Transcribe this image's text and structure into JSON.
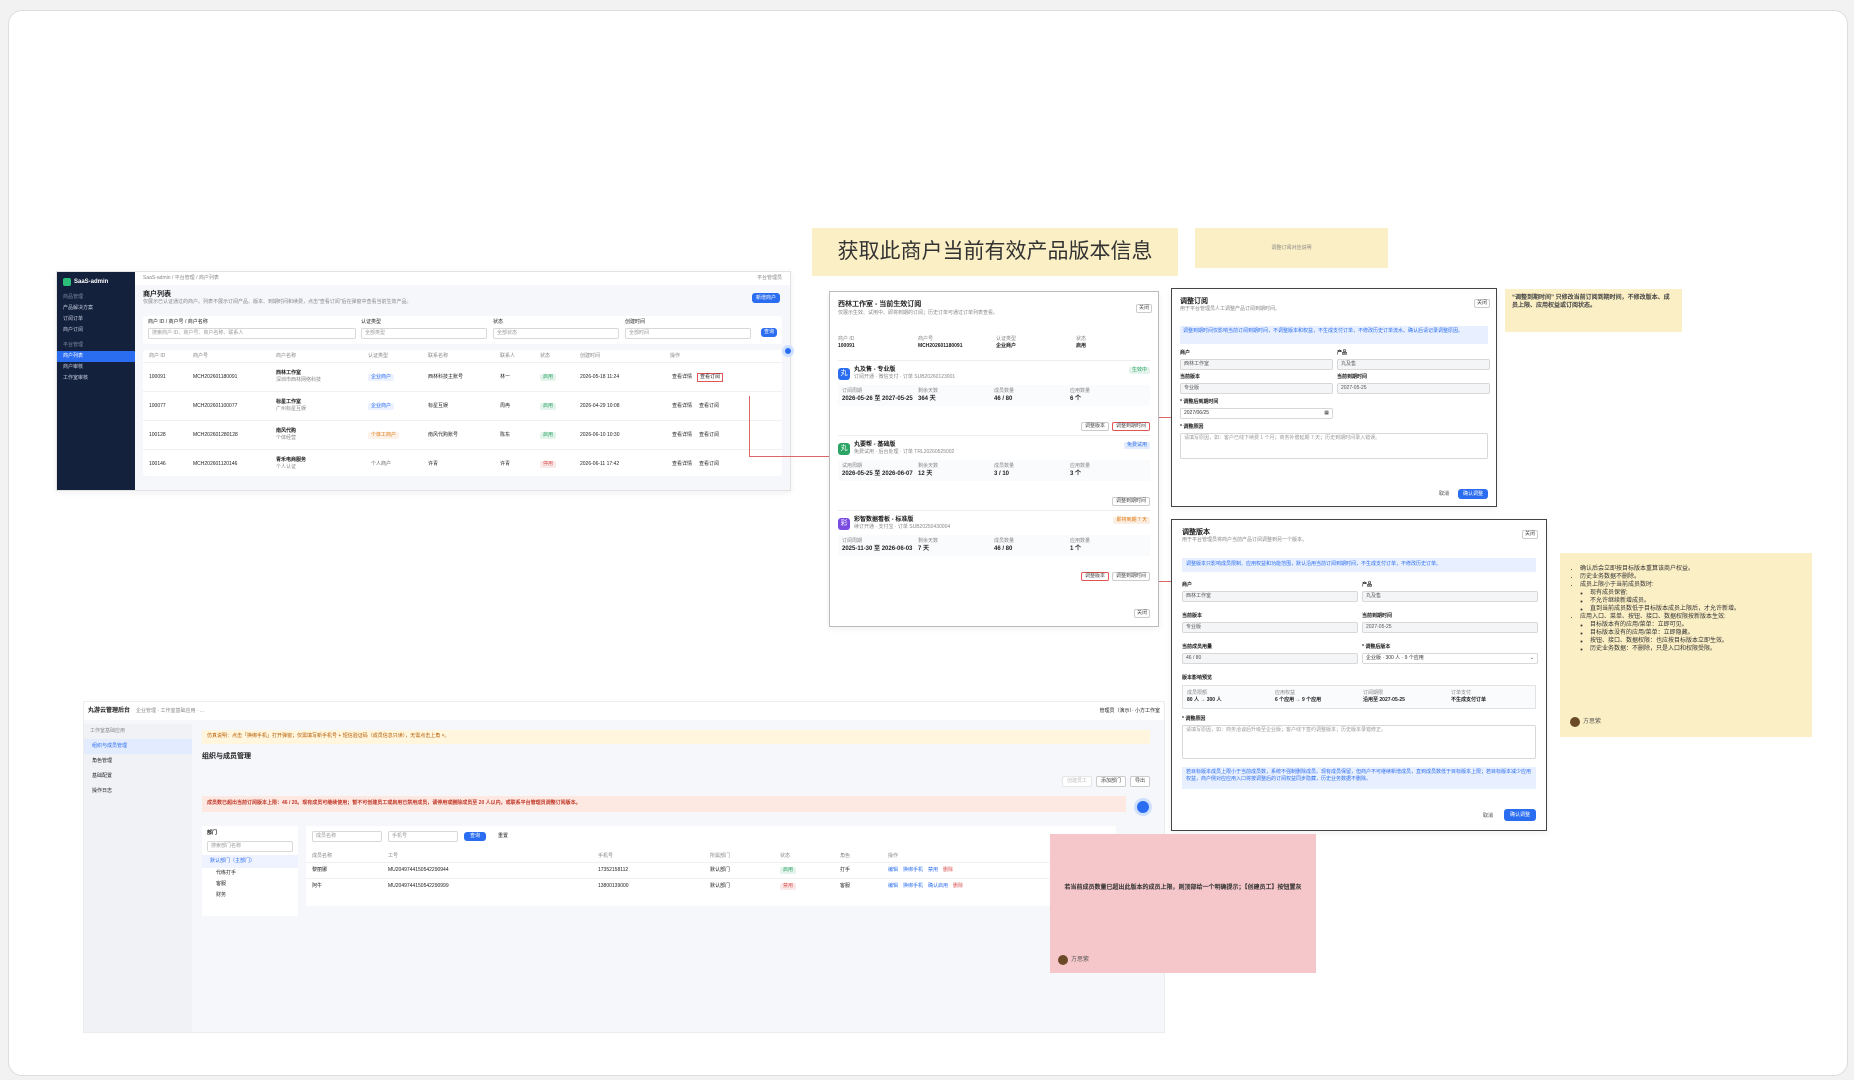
{
  "headline_note": {
    "text": "获取此商户当前有效产品版本信息"
  },
  "small_note": {
    "text": "调整订阅对应说明"
  },
  "right_note": {
    "text": "“调整到期时间” 只修改当前订阅到期时间，不修改版本、成员上限、应用权益或订阅状态。"
  },
  "rules_note": {
    "items": [
      {
        "text": "确认后会立即按目标版本重算该商户权益。"
      },
      {
        "text": "历史业务数据不删除。"
      },
      {
        "text": "成员上限小于当前成员数时:",
        "sub": [
          "现有成员保留;",
          "不允许继续新增成员。",
          "直到当前成员数低于目标版本成员上限后，才允许新增。"
        ]
      },
      {
        "text": "应用入口、菜单、按钮、接口、数据权限按新版本生效:",
        "sub": [
          "目标版本有的应用/菜单：立即可见。",
          "目标版本没有的应用/菜单：立即隐藏。",
          "按钮、接口、数据权限：也应按目标版本立即生效。",
          "历史业务数据：不删除，只是入口和权限受限。"
        ]
      }
    ],
    "author": "方思紫"
  },
  "pink_note": {
    "text": "若当前成员数量已超出此版本的成员上限，则顶部给一个明确提示；【创建员工】按钮置灰",
    "author": "方思紫"
  },
  "admin": {
    "brand": "SaaS-admin",
    "breadcrumb": "SaaS-admin / 平台管理 / 商户列表",
    "user": "平台管理员",
    "side_groups": [
      {
        "title": "商品管理",
        "items": [
          "产品解决方案",
          "订阅订单",
          "商户订阅"
        ]
      },
      {
        "title": "平台管理",
        "items": [
          "商户列表",
          "商户审核",
          "工作室审核"
        ]
      }
    ],
    "active_item": "商户列表",
    "title": "商户列表",
    "subtitle": "仅展示已认证通过的商户。列表不展示订阅产品、版本、到期时间和续费，点击\"查看订阅\"后在弹窗中查看当前生效产品。",
    "add_button": "新增商户",
    "filters": [
      {
        "label": "商户 ID / 商户号 / 商户名称",
        "placeholder": "搜索商户 ID、商户号、商户名称、联系人"
      },
      {
        "label": "认证类型",
        "placeholder": "全部类型"
      },
      {
        "label": "状态",
        "placeholder": "全部状态"
      },
      {
        "label": "创建时间",
        "placeholder": "全部时间"
      }
    ],
    "search_button": "查询",
    "columns": [
      "商户 ID",
      "商户号",
      "商户名称",
      "认证类型",
      "联系名称",
      "联系人",
      "状态",
      "创建时间",
      "操作"
    ],
    "rows": [
      {
        "id": "100091",
        "no": "MCH202601180091",
        "name": "西林工作室",
        "sub": "深圳市西林网络科技",
        "type": "企业商户",
        "contact": "西林科技主账号",
        "person": "林一",
        "status": "启用",
        "created": "2026-05-18 11:24",
        "ops": [
          "查看详情",
          "查看订阅"
        ]
      },
      {
        "id": "100077",
        "no": "MCH202601100077",
        "name": "标星工作室",
        "sub": "广州标星互娱",
        "type": "企业商户",
        "contact": "标星互娱",
        "person": "周冉",
        "status": "启用",
        "created": "2026-04-29 10:08",
        "ops": [
          "查看详情",
          "查看订阅"
        ]
      },
      {
        "id": "100128",
        "no": "MCH202601280128",
        "name": "南风代购",
        "sub": "个体经营",
        "type": "个体工商户",
        "contact": "南风代购账号",
        "person": "陈东",
        "status": "启用",
        "created": "2026-06-10 10:30",
        "ops": [
          "查看详情",
          "查看订阅"
        ]
      },
      {
        "id": "100146",
        "no": "MCH202601120146",
        "name": "青禾电商服务",
        "sub": "个人认证",
        "type": "个人商户",
        "contact": "许青",
        "person": "许青",
        "status": "停用",
        "created": "2026-06-11 17:42",
        "ops": [
          "查看详情",
          "查看订阅"
        ]
      }
    ]
  },
  "sub_modal": {
    "title": "西林工作室 - 当前生效订阅",
    "subtitle": "仅展示生效、试用中、即将到期的订阅；历史订单可通过订单列表查看。",
    "close": "关闭",
    "info": [
      {
        "label": "商户 ID",
        "value": "100091"
      },
      {
        "label": "商户号",
        "value": "MCH202601180091"
      },
      {
        "label": "认证类型",
        "value": "企业商户"
      },
      {
        "label": "状态",
        "value": "启用"
      }
    ],
    "cards": [
      {
        "badge": "丸",
        "color": "#2b6df0",
        "name": "丸及售 - 专业版",
        "meta": "订阅开通 · 微信支付 · 订单 SUB20260123001",
        "status": "生效中",
        "status_color": "#2aa565",
        "fields": [
          {
            "l": "订阅周期",
            "v": "2026-05-26 至 2027-05-25"
          },
          {
            "l": "剩余天数",
            "v": "364 天"
          },
          {
            "l": "成员数量",
            "v": "46 / 80"
          },
          {
            "l": "应用数量",
            "v": "6 个"
          }
        ],
        "actions": [
          "调整版本",
          "调整到期时间"
        ]
      },
      {
        "badge": "丸",
        "color": "#2aa565",
        "name": "丸要帮 - 基础版",
        "meta": "免费试用 · 后台处理 · 订单 TRL20260525002",
        "status": "免费试用",
        "status_color": "#2b6df0",
        "fields": [
          {
            "l": "试用周期",
            "v": "2026-05-25 至 2026-06-07"
          },
          {
            "l": "剩余天数",
            "v": "12 天"
          },
          {
            "l": "成员数量",
            "v": "3 / 10"
          },
          {
            "l": "应用数量",
            "v": "3 个"
          }
        ],
        "actions": [
          "调整到期时间"
        ]
      },
      {
        "badge": "彩",
        "color": "#7a4be0",
        "name": "彩智数据看板 - 标准版",
        "meta": "续订开通 · 支付宝 · 订单 SUB20250430004",
        "status": "即将到期 7 天",
        "status_color": "#e07a14",
        "fields": [
          {
            "l": "订阅周期",
            "v": "2025-11-30 至 2026-06-03"
          },
          {
            "l": "剩余天数",
            "v": "7 天"
          },
          {
            "l": "成员数量",
            "v": "46 / 80"
          },
          {
            "l": "应用数量",
            "v": "1 个"
          }
        ],
        "actions": [
          "调整版本",
          "调整到期时间"
        ]
      }
    ],
    "footer": "关闭"
  },
  "adjust_time": {
    "title": "调整订阅",
    "subtitle": "用于平台管理员人工调整产品订阅到期时间。",
    "close": "关闭",
    "alert": "调整到期时间仅影响当前订阅到期时间，不调整版本和权益，不生成支付订单，不修改历史订单流水。确认后请记录调整原因。",
    "f_merchant": "商户",
    "v_merchant": "西林工作室",
    "f_product": "产品",
    "v_product": "丸及售",
    "f_version": "当前版本",
    "v_version": "专业版",
    "f_expire": "当前到期时间",
    "v_expire": "2027-05-25",
    "f_new": "* 调整后到期时间",
    "v_new": "2027/06/25",
    "f_reason": "* 调整原因",
    "reason_ph": "请填写原因，如：客户已线下续费 1 个月；商务补偿延期 7 天；历史到期时间录入错误。",
    "cancel": "取消",
    "confirm": "确认调整"
  },
  "adjust_version": {
    "title": "调整版本",
    "subtitle": "用于平台管理员将商户当前产品订阅调整到另一个版本。",
    "close": "关闭",
    "alert": "调整版本只影响成员限制、应用权益和功能范围，默认沿用当前订阅到期时间，不生成支付订单，不修改历史订单。",
    "f_merchant": "商户",
    "v_merchant": "西林工作室",
    "f_product": "产品",
    "v_product": "丸及售",
    "f_version": "当前版本",
    "v_version": "专业版",
    "f_expire": "当前到期时间",
    "v_expire": "2027-05-25",
    "f_members": "当前成员用量",
    "v_members": "46 / 80",
    "f_target": "* 调整后版本",
    "v_target": "企业版 · 300 人 · 9 个应用",
    "preview_title": "版本影响预览",
    "preview": [
      {
        "l": "成员限额",
        "v": "80 人 → 300 人"
      },
      {
        "l": "应用权益",
        "v": "6 个应用 → 9 个应用"
      },
      {
        "l": "订阅期限",
        "v": "沿用至 2027-05-25"
      },
      {
        "l": "订单支付",
        "v": "不生成支付订单"
      }
    ],
    "f_reason": "* 调整原因",
    "reason_ph": "请填写原因，如：商务洽谈后升级至企业版；客户线下签约调整版本；历史版本录错修正。",
    "warning": "若目标版本成员上限小于当前成员数，系统不强制删除成员。现有成员保留，但商户不可继续新增成员，直到成员数低于目标版本上限；若目标版本减少应用权益，商户侧对应应用入口将按调整后的订阅权益同步隐藏，历史业务数据不删除。",
    "cancel": "取消",
    "confirm": "确认调整"
  },
  "org": {
    "brand": "丸游云管理后台",
    "breadcrumb": "企业管理 · 工作室基础应用 · ...",
    "user": "管理员（演示）· 小方工作室",
    "side_title": "工作室基础应用",
    "side_items": [
      "组织与成员管理",
      "角色管理",
      "基础配置",
      "操作日志"
    ],
    "active": "组织与成员管理",
    "notice": "仿真说明：点击「换绑手机」打开弹窗；仅需填写新手机号 + 短信验证码（成员信息只读），无需点击上角 ×。",
    "title": "组织与成员管理",
    "btn_create": "创建员工",
    "btn_add_dept": "添加部门",
    "btn_export": "导出",
    "warn": "成员数已超出当前订阅版本上限：46 / 20。现有成员可继续使用；暂不可创建员工或启用已禁用成员，请停用或删除成员至 20 人以内，或联系平台管理员调整订阅版本。",
    "dept_title": "部门",
    "dept_ph": "搜索部门名称",
    "depts": [
      "默认部门（主部门）",
      "代练打手",
      "客服",
      "财务"
    ],
    "q_name": "成员名称",
    "q_phone": "手机号",
    "btn_query": "查询",
    "btn_reset": "重置",
    "cols": [
      "成员名称",
      "工号",
      "手机号",
      "所属部门",
      "状态",
      "角色",
      "操作"
    ],
    "rows": [
      {
        "name": "黎丽娜",
        "no": "MU2049744150542290944",
        "phone": "17352158112",
        "dept": "默认部门",
        "status": "启用",
        "role": "打手",
        "ops": [
          "编辑",
          "换绑手机",
          "禁用",
          "删除"
        ]
      },
      {
        "name": "阿牛",
        "no": "MU2049744150542290999",
        "phone": "13800139000",
        "dept": "默认部门",
        "status": "禁用",
        "role": "客服",
        "ops": [
          "编辑",
          "换绑手机",
          "确认启用",
          "删除"
        ]
      }
    ]
  },
  "colors": {
    "primary": "#2b6df0",
    "sticky_yellow": "#fbefc5",
    "sticky_pink": "#f5c7ca",
    "sidebar": "#14213d"
  }
}
